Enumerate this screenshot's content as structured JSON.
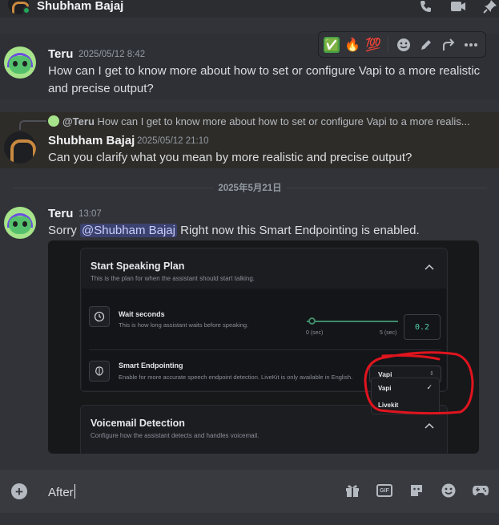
{
  "header": {
    "title": "Shubham Bajaj",
    "status_color": "#23a55a"
  },
  "header_icons": [
    "phone-icon",
    "video-icon",
    "pin-icon"
  ],
  "toolbar": {
    "reactions": [
      "✅",
      "🔥",
      "💯"
    ],
    "actions": [
      "add-reaction-icon",
      "edit-icon",
      "reply-icon",
      "more-icon"
    ]
  },
  "messages": [
    {
      "author": "Teru",
      "timestamp": "2025/05/12 8:42",
      "text": "How can I get to know more about how to set or configure Vapi to a more realistic and precise output?"
    },
    {
      "reply_mention": "@Teru",
      "reply_text": "How can I get to know more about how to set or configure Vapi to a more realis...",
      "author": "Shubham Bajaj",
      "timestamp": "2025/05/12 21:10",
      "text": "Can you clarify what you mean by more realistic and precise output?"
    },
    {
      "author": "Teru",
      "timestamp": "13:07",
      "text_before": "Sorry ",
      "mention": "@Shubham Bajaj",
      "text_after": " Right now this Smart Endpointing is enabled."
    }
  ],
  "date_divider": "2025年5月21日",
  "embed": {
    "panel1": {
      "title": "Start Speaking Plan",
      "subtitle": "This is the plan for when the assistant should start talking.",
      "wait": {
        "title": "Wait seconds",
        "subtitle": "This is how long assistant waits before speaking.",
        "min": "0 (sec)",
        "max": "5 (sec)",
        "value": "0.2"
      },
      "endpointing": {
        "title": "Smart Endpointing",
        "subtitle": "Enable for more accurate speech endpoint detection. LiveKit is only available in English.",
        "selected": "Vapi",
        "options": [
          "Vapi",
          "Livekit"
        ],
        "checkmark": "✓"
      }
    },
    "panel2": {
      "title": "Voicemail Detection",
      "subtitle": "Configure how the assistant detects and handles voicemail."
    },
    "annotation_color": "#e0141e"
  },
  "input": {
    "value": "After"
  },
  "input_icons": [
    "gift-icon",
    "gif-icon",
    "sticker-icon",
    "emoji-icon",
    "gamepad-icon"
  ]
}
